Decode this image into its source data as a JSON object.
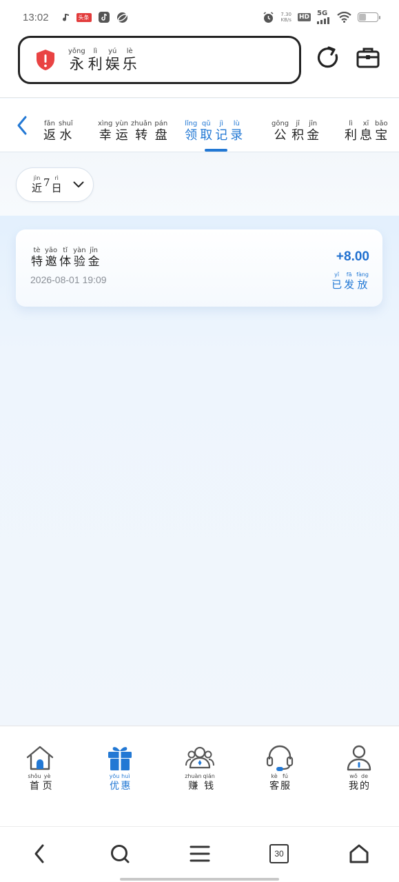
{
  "status_bar": {
    "time": "13:02",
    "badge": "头条",
    "net_speed_value": "7.30",
    "net_speed_unit": "KB/s",
    "hd": "HD",
    "network": "5G"
  },
  "header": {
    "brand": [
      {
        "py": "yǒng",
        "hz": "永"
      },
      {
        "py": "lì",
        "hz": "利"
      },
      {
        "py": "yú",
        "hz": "娱"
      },
      {
        "py": "lè",
        "hz": "乐"
      }
    ],
    "accent_color": "#2278d4",
    "shield_color": "#e94343"
  },
  "tabs": [
    {
      "chars": [
        {
          "py": "fǎn",
          "hz": "返"
        },
        {
          "py": "shuǐ",
          "hz": "水"
        }
      ],
      "active": false
    },
    {
      "chars": [
        {
          "py": "xìng",
          "hz": "幸"
        },
        {
          "py": "yùn",
          "hz": "运"
        },
        {
          "py": "zhuǎn",
          "hz": "转"
        },
        {
          "py": "pán",
          "hz": "盘"
        }
      ],
      "active": false
    },
    {
      "chars": [
        {
          "py": "lǐng",
          "hz": "领"
        },
        {
          "py": "qǔ",
          "hz": "取"
        },
        {
          "py": "jì",
          "hz": "记"
        },
        {
          "py": "lù",
          "hz": "录"
        }
      ],
      "active": true
    },
    {
      "chars": [
        {
          "py": "gōng",
          "hz": "公"
        },
        {
          "py": "jī",
          "hz": "积"
        },
        {
          "py": "jīn",
          "hz": "金"
        }
      ],
      "active": false
    },
    {
      "chars": [
        {
          "py": "lì",
          "hz": "利"
        },
        {
          "py": "xī",
          "hz": "息"
        },
        {
          "py": "bǎo",
          "hz": "宝"
        }
      ],
      "active": false
    }
  ],
  "filter": {
    "chars": [
      {
        "py": "jìn",
        "hz": "近"
      },
      {
        "py": "",
        "hz": "7"
      },
      {
        "py": "rì",
        "hz": "日"
      }
    ]
  },
  "records": [
    {
      "title": [
        {
          "py": "tè",
          "hz": "特"
        },
        {
          "py": "yāo",
          "hz": "邀"
        },
        {
          "py": "tǐ",
          "hz": "体"
        },
        {
          "py": "yàn",
          "hz": "验"
        },
        {
          "py": "jīn",
          "hz": "金"
        }
      ],
      "time": "2026-08-01 19:09",
      "amount": "+8.00",
      "status": [
        {
          "py": "yǐ",
          "hz": "已"
        },
        {
          "py": "fā",
          "hz": "发"
        },
        {
          "py": "fàng",
          "hz": "放"
        }
      ]
    }
  ],
  "bottom_nav": [
    {
      "icon": "home-icon",
      "chars": [
        {
          "py": "shǒu",
          "hz": "首"
        },
        {
          "py": "yè",
          "hz": "页"
        }
      ],
      "active": false
    },
    {
      "icon": "gift-icon",
      "chars": [
        {
          "py": "yōu",
          "hz": "优"
        },
        {
          "py": "huì",
          "hz": "惠"
        }
      ],
      "active": true
    },
    {
      "icon": "earn-icon",
      "chars": [
        {
          "py": "zhuàn",
          "hz": "赚"
        },
        {
          "py": "qián",
          "hz": "钱"
        }
      ],
      "active": false
    },
    {
      "icon": "headset-icon",
      "chars": [
        {
          "py": "kè",
          "hz": "客"
        },
        {
          "py": "fú",
          "hz": "服"
        }
      ],
      "active": false
    },
    {
      "icon": "user-icon",
      "chars": [
        {
          "py": "wǒ",
          "hz": "我"
        },
        {
          "py": "de",
          "hz": "的"
        }
      ],
      "active": false
    }
  ],
  "browser_bar": {
    "tab_count": "30"
  }
}
